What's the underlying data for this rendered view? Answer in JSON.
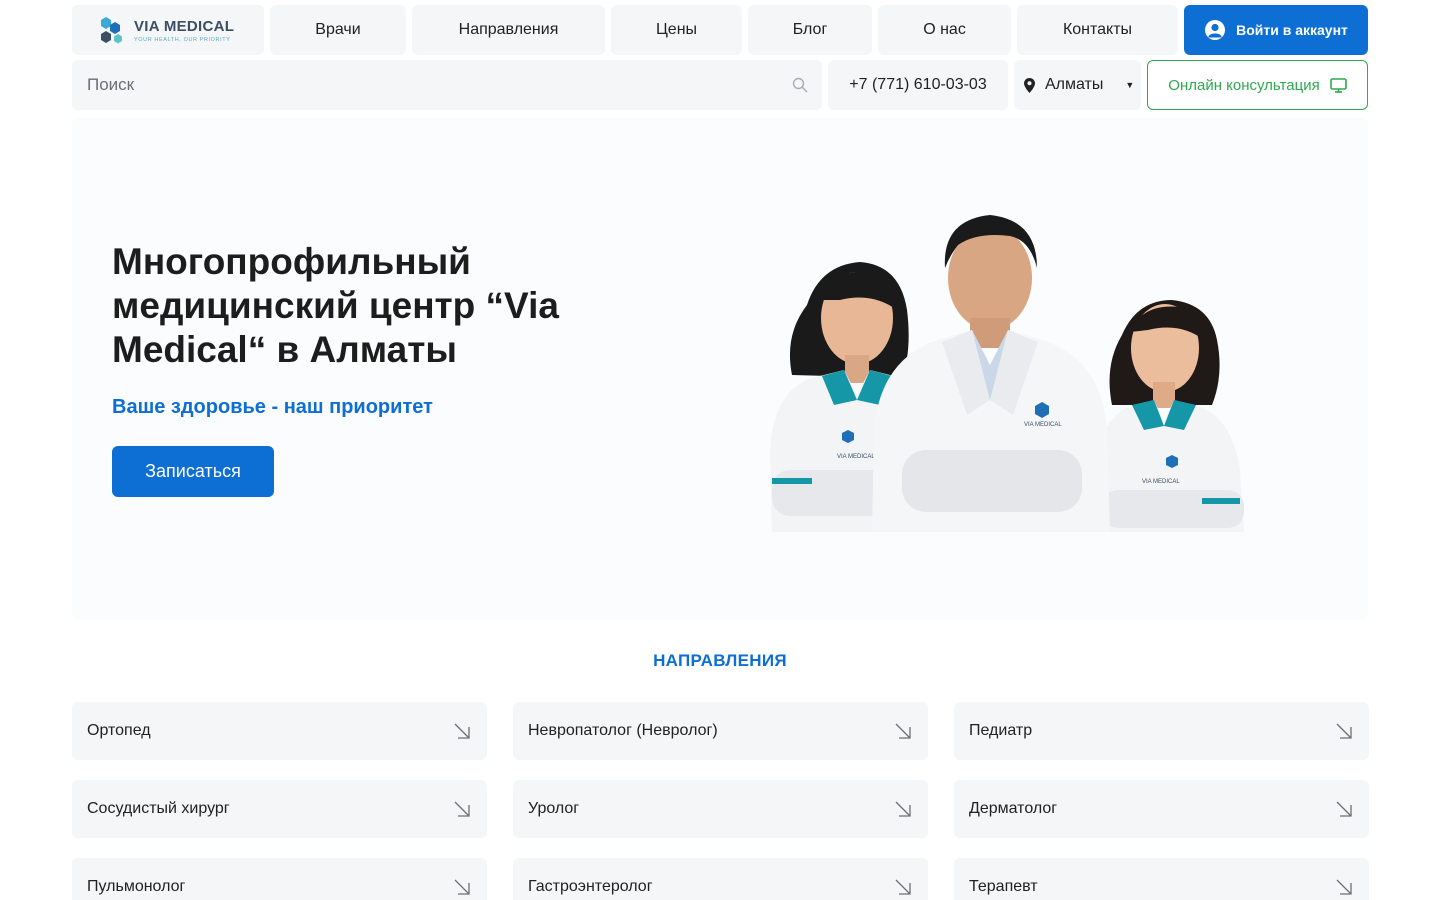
{
  "header": {
    "logo": {
      "name": "VIA MEDICAL",
      "tagline": "YOUR HEALTH, OUR PRIORITY"
    },
    "nav": [
      {
        "label": "Врачи",
        "name": "nav-doctors"
      },
      {
        "label": "Направления",
        "name": "nav-directions"
      },
      {
        "label": "Цены",
        "name": "nav-prices"
      },
      {
        "label": "Блог",
        "name": "nav-blog"
      },
      {
        "label": "О нас",
        "name": "nav-about"
      },
      {
        "label": "Контакты",
        "name": "nav-contacts"
      }
    ],
    "login_label": "Войти в аккаунт",
    "search_placeholder": "Поиск",
    "phone": "+7 (771) 610-03-03",
    "city": "Алматы",
    "online_label": "Онлайн консультация"
  },
  "hero": {
    "title": "Многопрофильный медицинский центр “Via Medical“ в Алматы",
    "subtitle": "Ваше здоровье - наш приоритет",
    "cta_label": "Записаться",
    "badge_text": "VIA MEDICAL"
  },
  "directions": {
    "title": "НАПРАВЛЕНИЯ",
    "items": [
      "Ортопед",
      "Невропатолог (Невролог)",
      "Педиатр",
      "Сосудистый хирург",
      "Уролог",
      "Дерматолог",
      "Пульмонолог",
      "Гастроэнтеролог",
      "Терапевт"
    ]
  },
  "colors": {
    "primary": "#0d6ed4",
    "green": "#2fa84f",
    "panel": "#f4f6f8",
    "teal": "#1597a8"
  },
  "icons": {
    "search": "search-icon",
    "user": "user-icon",
    "location": "location-pin-icon",
    "caret": "caret-down-icon",
    "monitor": "monitor-icon",
    "arrow": "arrow-down-right-icon"
  }
}
